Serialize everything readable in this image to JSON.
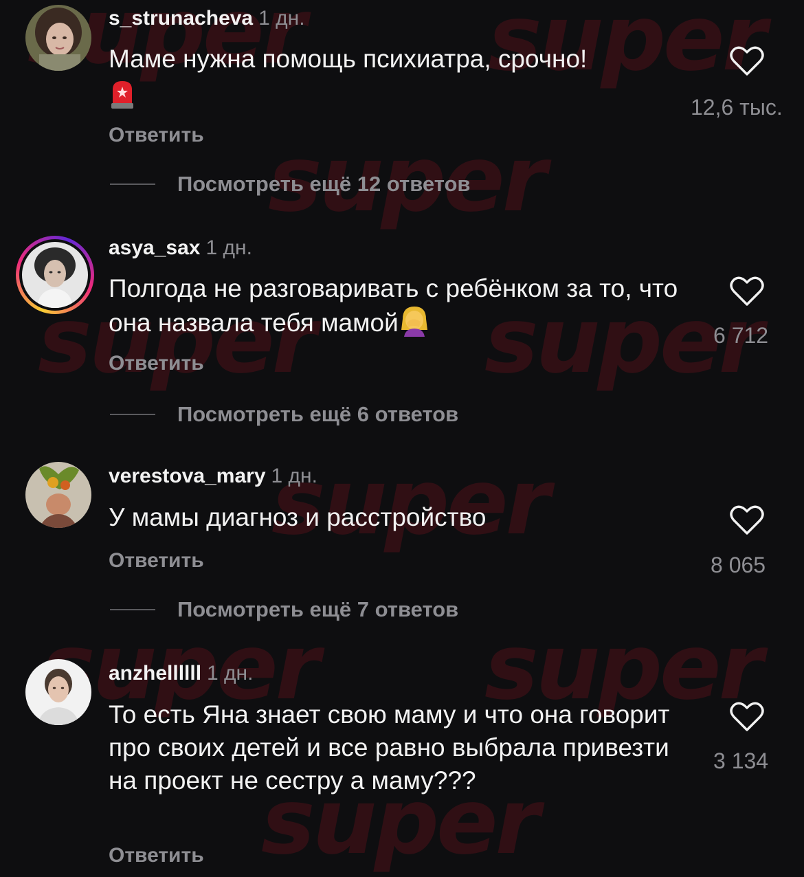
{
  "watermark": "super",
  "comments": [
    {
      "username": "s_strunacheva",
      "time": "1 дн.",
      "text": "Маме нужна помощь психиатра, срочно!",
      "emoji": "police-light-emoji",
      "likes": "12,6 тыс.",
      "reply_label": "Ответить",
      "more_replies": "Посмотреть ещё 12 ответов",
      "has_story_ring": false
    },
    {
      "username": "asya_sax",
      "time": "1 дн.",
      "text": "Полгода не разговаривать с ребёнком за то, что она назвала тебя мамой",
      "emoji": "woman-facepalming-emoji",
      "likes": "6 712",
      "reply_label": "Ответить",
      "more_replies": "Посмотреть ещё 6 ответов",
      "has_story_ring": true
    },
    {
      "username": "verestova_mary",
      "time": "1 дн.",
      "text": "У мамы диагноз и расстройство",
      "likes": "8 065",
      "reply_label": "Ответить",
      "more_replies": "Посмотреть ещё 7 ответов",
      "has_story_ring": false
    },
    {
      "username": "anzhellllll",
      "time": "1 дн.",
      "text": "То есть Яна знает свою маму и что она говорит про своих детей и все равно выбрала привезти на проект не сестру а маму???",
      "likes": "3 134",
      "reply_label": "Ответить",
      "has_story_ring": false
    }
  ],
  "colors": {
    "background": "#0e0e10",
    "text": "#f2f2f2",
    "muted": "#8e8e93",
    "watermark": "#78141e"
  },
  "icons": {
    "like": "heart-outline-icon"
  }
}
